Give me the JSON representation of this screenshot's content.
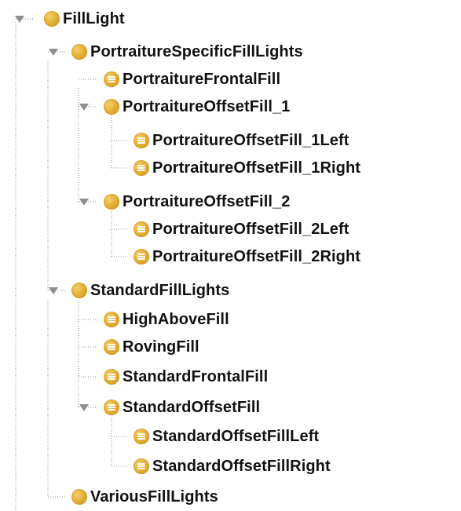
{
  "tree": {
    "colors": {
      "connector": "#8b8b8b",
      "toggle": "#8d8d8d",
      "node_fill": "#e0aa2d",
      "text": "#111111"
    },
    "nodes": [
      {
        "label": "FillLight",
        "kind": "class",
        "depth": 0,
        "expanded": true,
        "icon": "class-circle-icon"
      },
      {
        "label": "PortraitureSpecificFillLights",
        "kind": "class",
        "depth": 1,
        "expanded": true,
        "icon": "class-circle-icon"
      },
      {
        "label": "PortraitureFrontalFill",
        "kind": "individual",
        "depth": 2,
        "expanded": false,
        "icon": "individual-icon"
      },
      {
        "label": "PortraitureOffsetFill_1",
        "kind": "class",
        "depth": 2,
        "expanded": true,
        "icon": "class-circle-icon"
      },
      {
        "label": "PortraitureOffsetFill_1Left",
        "kind": "individual",
        "depth": 3,
        "expanded": false,
        "icon": "individual-icon"
      },
      {
        "label": "PortraitureOffsetFill_1Right",
        "kind": "individual",
        "depth": 3,
        "expanded": false,
        "icon": "individual-icon"
      },
      {
        "label": "PortraitureOffsetFill_2",
        "kind": "class",
        "depth": 2,
        "expanded": true,
        "icon": "class-circle-icon"
      },
      {
        "label": "PortraitureOffsetFill_2Left",
        "kind": "individual",
        "depth": 3,
        "expanded": false,
        "icon": "individual-icon"
      },
      {
        "label": "PortraitureOffsetFill_2Right",
        "kind": "individual",
        "depth": 3,
        "expanded": false,
        "icon": "individual-icon"
      },
      {
        "label": "StandardFillLights",
        "kind": "class",
        "depth": 1,
        "expanded": true,
        "icon": "class-circle-icon"
      },
      {
        "label": "HighAboveFill",
        "kind": "individual",
        "depth": 2,
        "expanded": false,
        "icon": "individual-icon"
      },
      {
        "label": "RovingFill",
        "kind": "individual",
        "depth": 2,
        "expanded": false,
        "icon": "individual-icon"
      },
      {
        "label": "StandardFrontalFill",
        "kind": "individual",
        "depth": 2,
        "expanded": false,
        "icon": "individual-icon"
      },
      {
        "label": "StandardOffsetFill",
        "kind": "individual",
        "depth": 2,
        "expanded": true,
        "icon": "individual-icon"
      },
      {
        "label": "StandardOffsetFillLeft",
        "kind": "individual",
        "depth": 3,
        "expanded": false,
        "icon": "individual-icon"
      },
      {
        "label": "StandardOffsetFillRight",
        "kind": "individual",
        "depth": 3,
        "expanded": false,
        "icon": "individual-icon"
      },
      {
        "label": "VariousFillLights",
        "kind": "class",
        "depth": 1,
        "expanded": false,
        "icon": "class-circle-icon"
      }
    ]
  }
}
